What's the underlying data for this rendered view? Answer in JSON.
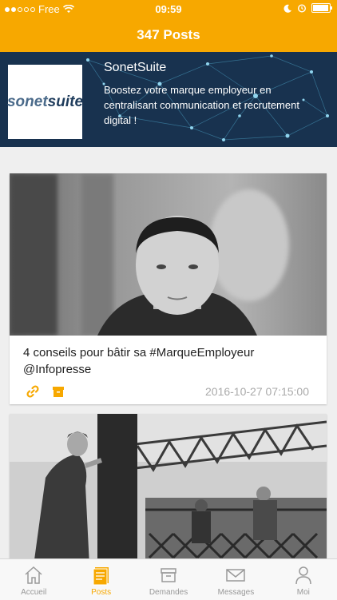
{
  "status_bar": {
    "carrier": "Free",
    "time": "09:59"
  },
  "nav": {
    "title": "347 Posts"
  },
  "banner": {
    "name": "SonetSuite",
    "description": "Boostez votre marque employeur en centralisant communication et recrutement digital !",
    "logo_text_light": "sonet",
    "logo_text_bold": "suite"
  },
  "posts": [
    {
      "title": "4 conseils pour bâtir sa #MarqueEmployeur @Infopresse",
      "date": "2016-10-27 07:15:00"
    }
  ],
  "tabs": [
    {
      "label": "Accueil",
      "icon": "home-icon"
    },
    {
      "label": "Posts",
      "icon": "posts-icon"
    },
    {
      "label": "Demandes",
      "icon": "inbox-icon"
    },
    {
      "label": "Messages",
      "icon": "envelope-icon"
    },
    {
      "label": "Moi",
      "icon": "person-icon"
    }
  ],
  "colors": {
    "accent": "#F7A800",
    "banner_bg": "#18324f"
  }
}
